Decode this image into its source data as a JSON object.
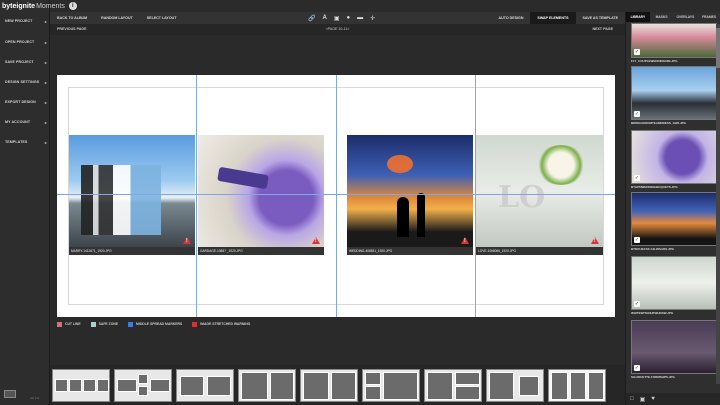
{
  "app": {
    "logo_bold": "byteignite",
    "logo_light": "Moments",
    "info_icon": "info-icon",
    "version": "ver 1.0"
  },
  "left_menu": [
    {
      "label": "NEW PROJECT"
    },
    {
      "label": "OPEN PROJECT"
    },
    {
      "label": "SAVE PROJECT"
    },
    {
      "label": "DESIGN SETTINGS"
    },
    {
      "label": "EXPORT DESIGN"
    },
    {
      "label": "MY ACCOUNT"
    },
    {
      "label": "TEMPLATES"
    }
  ],
  "toolbar": {
    "back": "BACK TO ALBUM",
    "random": "RANDOM LAYOUT",
    "select": "SELECT LAYOUT",
    "auto": "AUTO DESIGN",
    "swap": "SWAP ELEMENTS",
    "save_template": "SAVE AS TEMPLATE",
    "tool_icons": [
      "link-icon",
      "text-icon",
      "lock-icon",
      "fill-icon",
      "image-icon",
      "center-icon"
    ]
  },
  "pagenav": {
    "prev": "PREVIOUS PAGE",
    "page": "<PAGE 10-11>",
    "next": "NEXT PAGE"
  },
  "photos": [
    {
      "caption": "MARRY-1412671_1920.JPG",
      "warning": true
    },
    {
      "caption": "GARDAGE-1088? _1920.JPG",
      "warning": true
    },
    {
      "caption": "WEDDING-408831_1920.JPG",
      "warning": true
    },
    {
      "caption": "LOVE-1066066_1920.JPG",
      "warning": true
    }
  ],
  "legend": [
    {
      "label": "CUT LINE",
      "color": "#e36a7a"
    },
    {
      "label": "SAFE ZONE",
      "color": "#9fd6c9"
    },
    {
      "label": "MIDDLE SPREAD MARKERS",
      "color": "#3d7be0"
    },
    {
      "label": "IMAGE STRETCHED WARNING",
      "color": "#d33333"
    }
  ],
  "right_panel": {
    "tabs": [
      {
        "label": "LIBRARY",
        "active": true
      },
      {
        "label": "MASKS",
        "active": false
      },
      {
        "label": "OVERLAYS",
        "active": false
      },
      {
        "label": "FRAMES",
        "active": false
      }
    ],
    "thumbs": [
      {
        "caption": "FLY_COUPLEWEDDING02B.JPG"
      },
      {
        "caption": "BRIDEGROOMTEAMDRESS_1920.JPG"
      },
      {
        "caption": "BYHPNWEDDINGBOQUETS.JPG"
      },
      {
        "caption": "BTDOUECSF-CB.WAHOS.JPG"
      },
      {
        "caption": "WHITEWITHNHFWHRAW.JPG"
      },
      {
        "caption": "SILHOUETTE-FORMSHPS.JPG"
      }
    ]
  },
  "layouts_count": 10
}
